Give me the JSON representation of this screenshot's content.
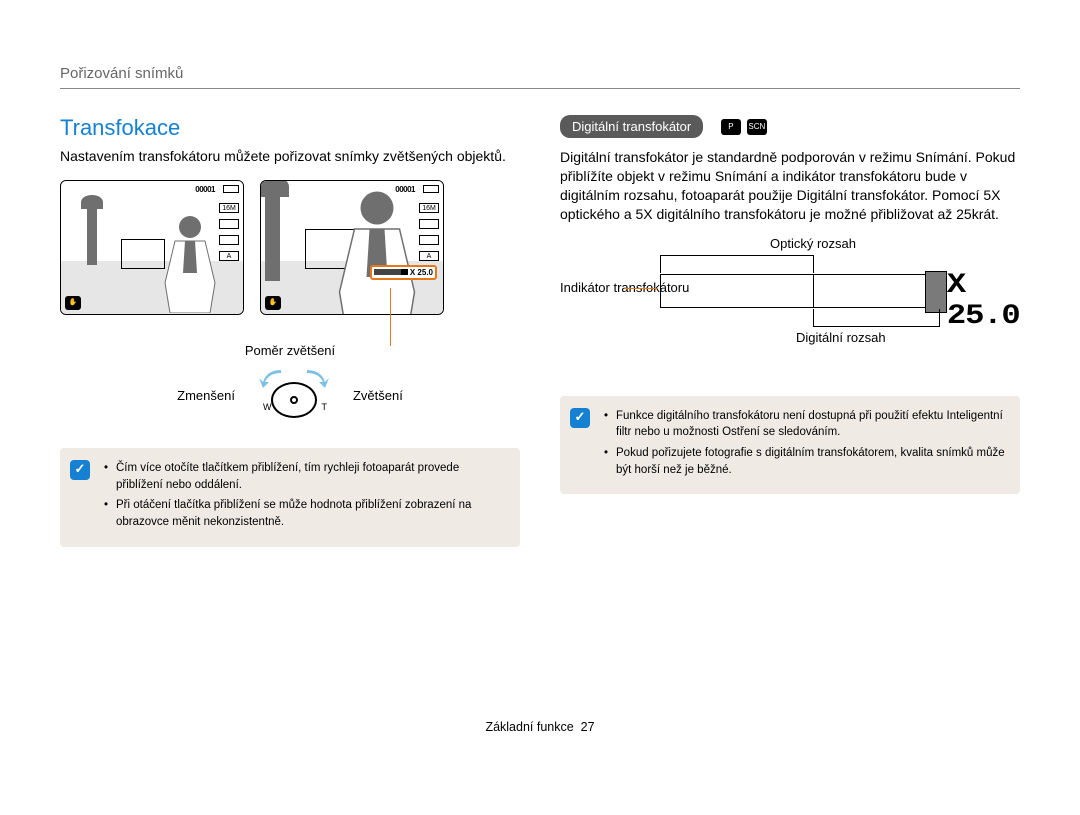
{
  "breadcrumb": "Pořizování snímků",
  "left": {
    "title": "Transfokace",
    "intro": "Nastavením transfokátoru můžete pořizovat snímky zvětšených objektů.",
    "lcd": {
      "counter": "00001",
      "res": "16M",
      "zoom_badge": "X 25.0"
    },
    "caption_ratio": "Poměr zvětšení",
    "dial_left": "Zmenšení",
    "dial_right": "Zvětšení",
    "dial_w": "W",
    "dial_t": "T",
    "notes": [
      "Čím více otočíte tlačítkem přiblížení, tím rychleji fotoaparát provede přiblížení nebo oddálení.",
      "Při otáčení tlačítka přiblížení se může hodnota přiblížení zobrazení na obrazovce měnit nekonzistentně."
    ]
  },
  "right": {
    "pill": "Digitální transfokátor",
    "mode1": "P",
    "mode2": "SCN",
    "paragraph": "Digitální transfokátor je standardně podporován v režimu Snímání. Pokud přiblížíte objekt v režimu Snímání a indikátor transfokátoru bude v digitálním rozsahu, fotoaparát použije Digitální transfokátor. Pomocí 5X optického a 5X digitálního transfokátoru je možné přibližovat až 25krát.",
    "diagram": {
      "top": "Optický rozsah",
      "left": "Indikátor transfokátoru",
      "bottom": "Digitální rozsah",
      "value": "X 25.0"
    },
    "notes": [
      "Funkce digitálního transfokátoru není dostupná při použití efektu Inteligentní filtr nebo u možnosti Ostření se sledováním.",
      "Pokud pořizujete fotografie s digitálním transfokátorem, kvalita snímků může být horší než je běžné."
    ]
  },
  "footer": {
    "label": "Základní funkce",
    "page": "27"
  }
}
